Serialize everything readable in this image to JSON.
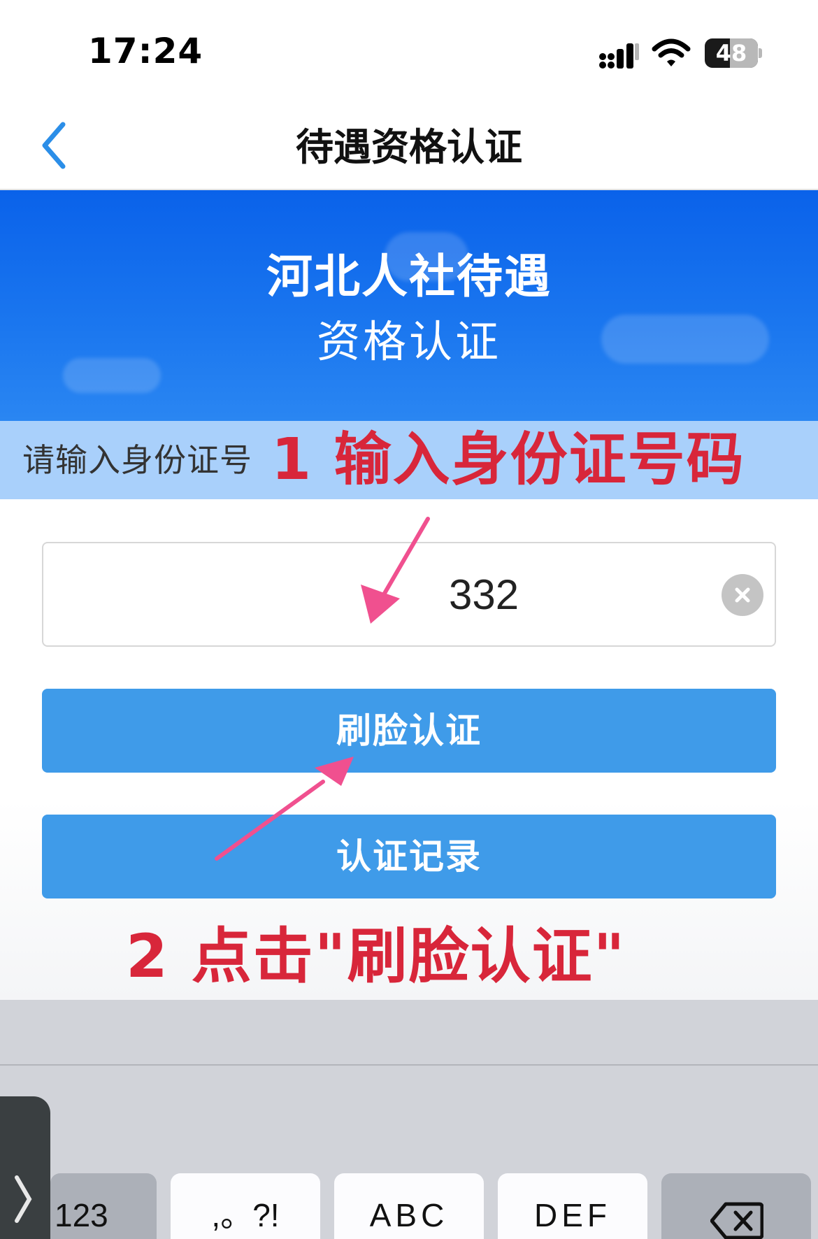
{
  "status_bar": {
    "time": "17:24",
    "battery_level": "48"
  },
  "nav": {
    "title": "待遇资格认证"
  },
  "hero": {
    "title": "河北人社待遇",
    "subtitle": "资格认证"
  },
  "form": {
    "id_label": "请输入身份证号",
    "id_value": "332",
    "face_auth_label": "刷脸认证",
    "records_label": "认证记录"
  },
  "annotations": {
    "step1": "1 输入身份证号码",
    "step2": "2 点击\"刷脸认证\""
  },
  "keyboard": {
    "key_123": "123",
    "key_punct": ",。?!",
    "key_abc": "ABC",
    "key_def": "DEF"
  },
  "colors": {
    "nav_accent": "#3f9be9",
    "hero_blue": "#0a62ea",
    "annotation_red": "#d8263a",
    "arrow_pink": "#f0508f"
  }
}
